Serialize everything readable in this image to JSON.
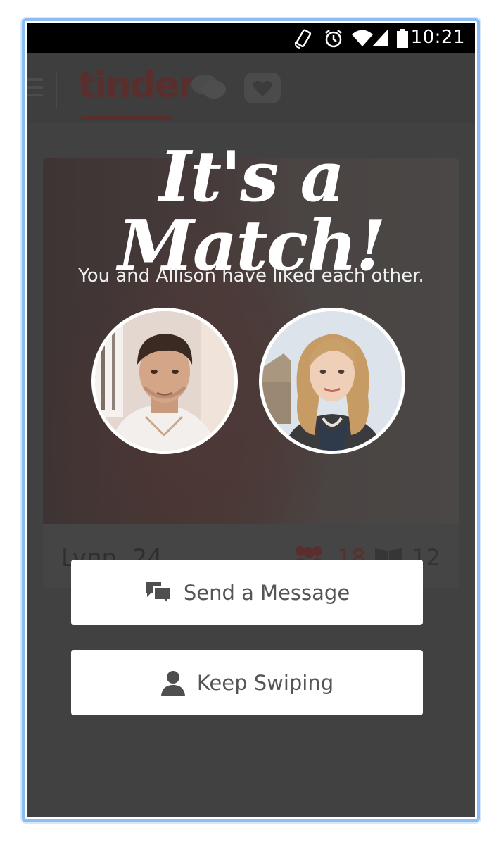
{
  "status_bar": {
    "time": "10:21",
    "icons": [
      "rotate-icon",
      "alarm-icon",
      "wifi-icon",
      "cell-signal-icon",
      "battery-icon"
    ]
  },
  "background_app": {
    "logo": "tinder",
    "profile_name": "Lynn, 24",
    "friends_count": "18",
    "interests_count": "12",
    "icons": [
      "menu-icon",
      "chat-icon",
      "heart-icon",
      "friends-icon",
      "book-icon"
    ]
  },
  "match": {
    "title": "It's a Match!",
    "subtitle": "You and Allison have liked each other."
  },
  "buttons": {
    "send_message": "Send a Message",
    "keep_swiping": "Keep Swiping"
  },
  "colors": {
    "overlay": "#414141",
    "brand": "#5a2e2d",
    "frame": "#8cbcf4"
  }
}
